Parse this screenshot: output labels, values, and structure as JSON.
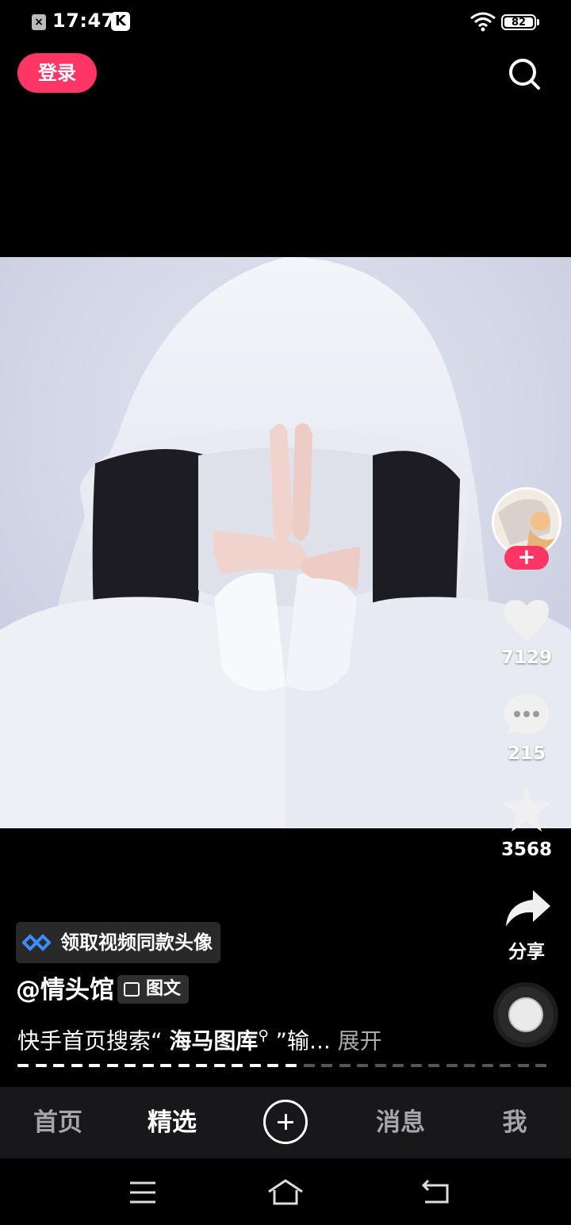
{
  "status_bar": {
    "time": "17:47",
    "battery": "82",
    "left_icons": [
      "close-box-icon",
      "k-app-icon"
    ],
    "right_icons": [
      "wifi-icon",
      "battery-icon"
    ]
  },
  "header": {
    "login_label": "登录",
    "search_icon": "search-icon"
  },
  "post": {
    "author": "@情头馆",
    "type_tag": "图文",
    "promo_label": "领取视频同款头像",
    "description_prefix": "快手首页搜索“",
    "description_keyword": "海马图库",
    "description_suffix": "”输...",
    "expand_label": "展开",
    "image_progress": {
      "total": 30,
      "viewed": 16
    }
  },
  "actions": {
    "likes": "7129",
    "comments": "215",
    "favorites": "3568",
    "share_label": "分享"
  },
  "tabbar": {
    "tabs": [
      "首页",
      "精选",
      "消息",
      "我"
    ],
    "active": "精选"
  },
  "colors": {
    "accent": "#fe3666",
    "tabbar_bg": "#18181b"
  }
}
